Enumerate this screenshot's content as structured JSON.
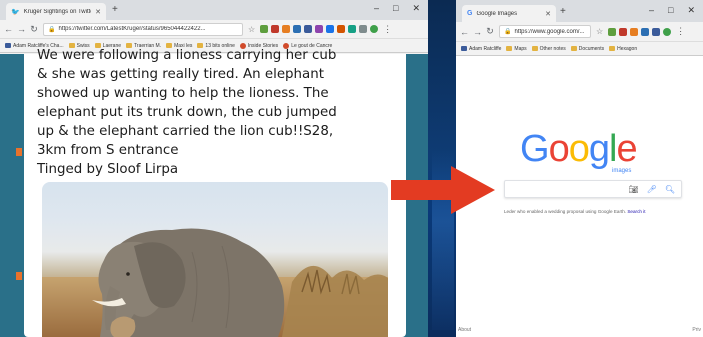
{
  "left_browser": {
    "tab_title": "Kruger Sightings on Twitter: \"W",
    "url": "https://twitter.com/LatestKruger/status/965044422422...",
    "bookmarks": [
      "Adam Ratcliffe's Cha...",
      "Swiss",
      "Laerane",
      "Traerrian M.",
      "Maxi les",
      "13 bits online",
      "Inside Stories",
      "Le gout de Cancre"
    ],
    "tweet_lines": [
      "We were following a lioness carrying her cub",
      "& she was getting really tired. An elephant",
      "showed up wanting to help the lioness. The",
      "elephant put its trunk down, the cub jumped",
      "up & the elephant carried the lion cub!!S28,",
      "3km from S entrance",
      "Tinged by Sloof Lirpa"
    ]
  },
  "right_browser": {
    "tab_title": "Google Images",
    "url": "https://www.google.com/...",
    "bookmarks": [
      "Adam Ratcliffe",
      "Maps",
      "Other notes",
      "Documents",
      "Hexagon"
    ],
    "logo_letters": [
      {
        "char": "G",
        "color": "#4285f4"
      },
      {
        "char": "o",
        "color": "#ea4335"
      },
      {
        "char": "o",
        "color": "#fbbc05"
      },
      {
        "char": "g",
        "color": "#4285f4"
      },
      {
        "char": "l",
        "color": "#34a853"
      },
      {
        "char": "e",
        "color": "#ea4335"
      }
    ],
    "logo_sub": "images",
    "promo_text": "Leder who enabled a wedding proposal using Google Earth.",
    "promo_link": "Search it",
    "footer_left": "About",
    "footer_right": "Priv"
  },
  "colors": {
    "arrow": "#e33b22",
    "twitter_bg": "#2a7089"
  }
}
